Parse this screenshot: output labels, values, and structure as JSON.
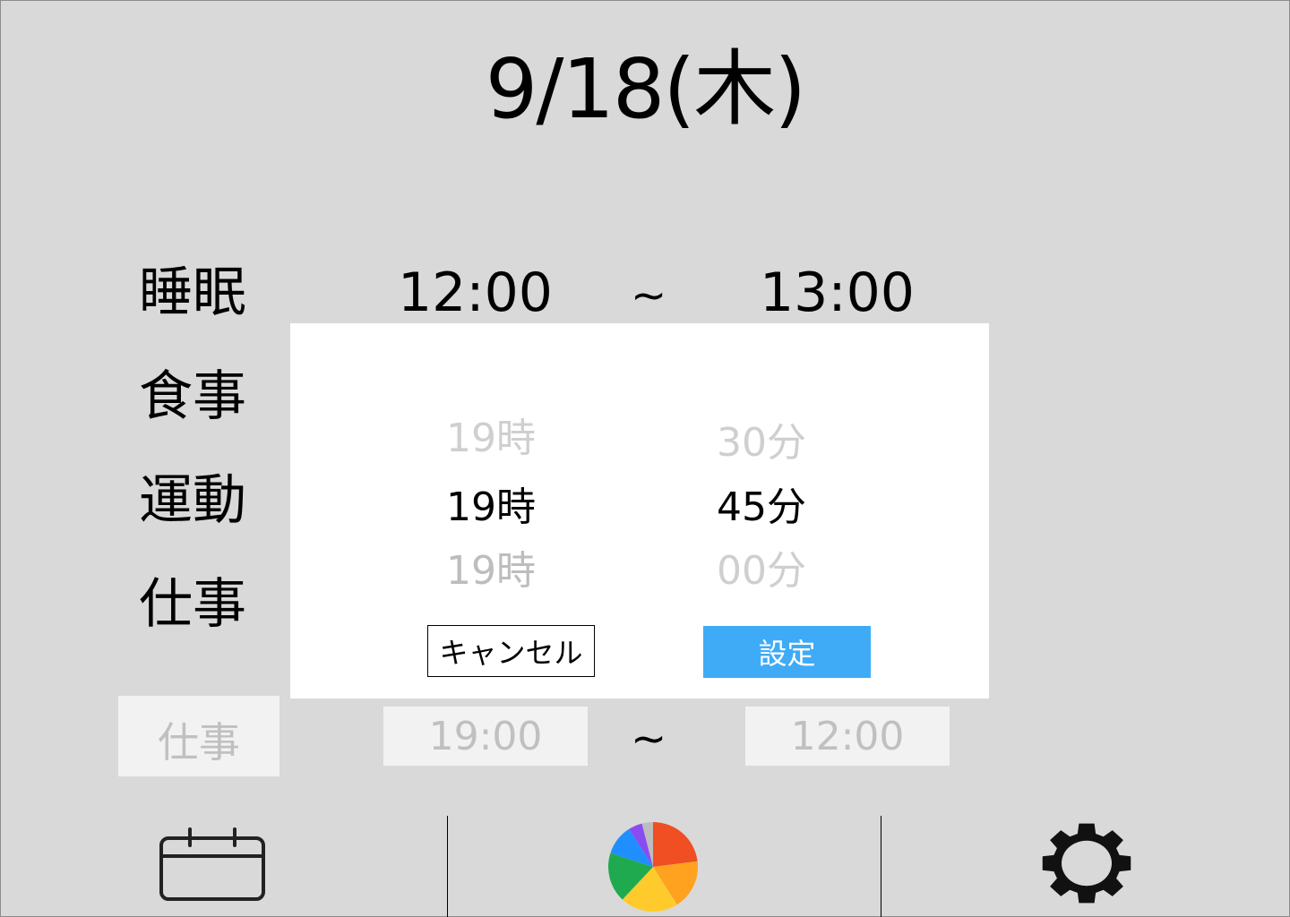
{
  "header": {
    "date": "9/18(木)"
  },
  "entries": [
    {
      "category": "睡眠",
      "start": "12:00",
      "end": "13:00"
    },
    {
      "category": "食事"
    },
    {
      "category": "運動"
    },
    {
      "category": "仕事"
    }
  ],
  "separator": "~",
  "new_entry": {
    "category_placeholder": "仕事",
    "start_placeholder": "19:00",
    "end_placeholder": "12:00"
  },
  "time_picker": {
    "hour_column": {
      "above": "19時",
      "selected": "19時",
      "below": "19時"
    },
    "minute_column": {
      "above": "30分",
      "selected": "45分",
      "below": "00分"
    },
    "cancel_label": "キャンセル",
    "confirm_label": "設定"
  },
  "bottom_nav": {
    "items": [
      {
        "icon": "calendar-icon"
      },
      {
        "icon": "pie-chart-icon"
      },
      {
        "icon": "gear-icon"
      }
    ]
  },
  "colors": {
    "background": "#d9d9d9",
    "confirm_button": "#3fabf7",
    "pie_slices": [
      "#f04e23",
      "#ffa21f",
      "#ffcb2c",
      "#1faa4f",
      "#1f8fff",
      "#8a4cf0",
      "#bdbdbd"
    ]
  }
}
